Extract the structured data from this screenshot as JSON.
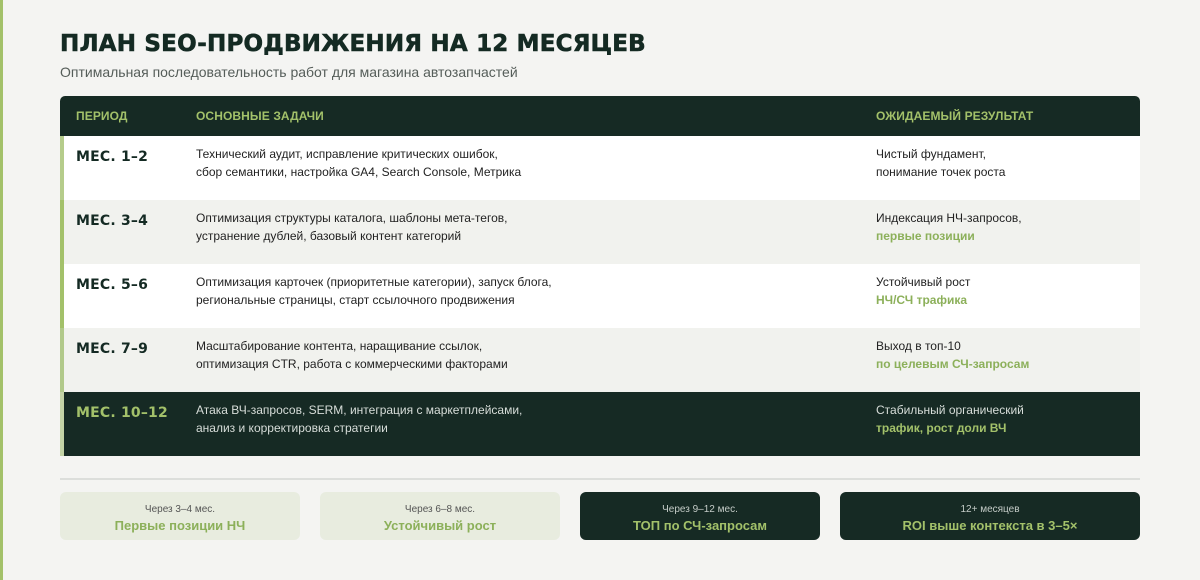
{
  "header": {
    "title": "ПЛАН SEO-ПРОДВИЖЕНИЯ НА 12 МЕСЯЦЕВ",
    "subtitle": "Оптимальная последовательность работ для магазина автозапчастей"
  },
  "table": {
    "columns": {
      "period": "ПЕРИОД",
      "tasks": "ОСНОВНЫЕ ЗАДАЧИ",
      "result": "ОЖИДАЕМЫЙ РЕЗУЛЬТАТ"
    },
    "rows": [
      {
        "period": "МЕС. 1–2",
        "tasks": [
          "Технический аудит, исправление критических ошибок,",
          "сбор семантики, настройка GA4, Search Console, Метрика"
        ],
        "result_plain": "Чистый фундамент,",
        "result_second": "понимание точек роста"
      },
      {
        "period": "МЕС. 3–4",
        "tasks": [
          "Оптимизация структуры каталога, шаблоны мета-тегов,",
          "устранение дублей, базовый контент категорий"
        ],
        "result_plain": "Индексация НЧ-запросов,",
        "result_highlight": "первые позиции"
      },
      {
        "period": "МЕС. 5–6",
        "tasks": [
          "Оптимизация карточек (приоритетные категории), запуск блога,",
          "региональные страницы, старт ссылочного продвижения"
        ],
        "result_plain": "Устойчивый рост",
        "result_highlight": "НЧ/СЧ трафика"
      },
      {
        "period": "МЕС. 7–9",
        "tasks": [
          "Масштабирование контента, наращивание ссылок,",
          "оптимизация CTR, работа с коммерческими факторами"
        ],
        "result_plain": "Выход в топ-10",
        "result_highlight": "по целевым СЧ-запросам"
      },
      {
        "period": "МЕС. 10–12",
        "tasks": [
          "Атака ВЧ-запросов, SERM, интеграция с маркетплейсами,",
          "анализ и корректировка стратегии"
        ],
        "result_plain": "Стабильный органический",
        "result_highlight": "трафик, рост доли ВЧ"
      }
    ]
  },
  "milestones": [
    {
      "when": "Через 3–4 мес.",
      "what": "Первые позиции НЧ"
    },
    {
      "when": "Через 6–8 мес.",
      "what": "Устойчивый рост"
    },
    {
      "when": "Через 9–12 мес.",
      "what": "ТОП по СЧ-запросам"
    },
    {
      "when": "12+ месяцев",
      "what": "ROI выше контекста в 3–5×"
    }
  ],
  "colors": {
    "accent": "#a3c16a",
    "dark": "#162a24",
    "background": "#f4f4f2"
  }
}
